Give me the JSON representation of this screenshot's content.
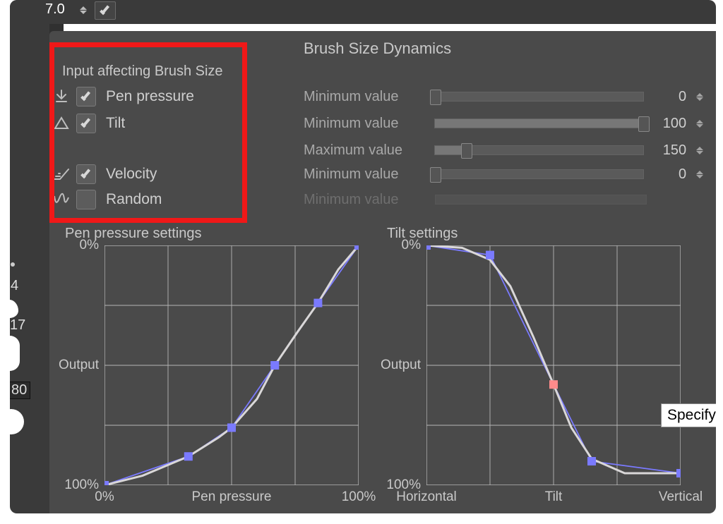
{
  "top": {
    "value": "7.0"
  },
  "panel": {
    "title": "Brush Size Dynamics"
  },
  "inputs": {
    "section_title": "Input affecting Brush Size",
    "items": [
      {
        "label": "Pen pressure",
        "checked": true,
        "icon": "pressure-icon"
      },
      {
        "label": "Tilt",
        "checked": true,
        "icon": "tilt-icon"
      },
      {
        "label": "Velocity",
        "checked": true,
        "icon": "velocity-icon"
      },
      {
        "label": "Random",
        "checked": false,
        "icon": "random-icon"
      }
    ]
  },
  "sliders": [
    {
      "label": "Minimum value",
      "value": 0,
      "min": 0,
      "max": 100,
      "disabled": false
    },
    {
      "label": "Minimum value",
      "value": 100,
      "min": 0,
      "max": 100,
      "disabled": false
    },
    {
      "label": "Maximum value",
      "value": 150,
      "min": 0,
      "max": 1000,
      "disabled": false
    },
    {
      "label": "Minimum value",
      "value": 0,
      "min": 0,
      "max": 100,
      "disabled": false
    },
    {
      "label": "Minimum value",
      "value": "",
      "min": 0,
      "max": 100,
      "disabled": true
    }
  ],
  "chart_data": [
    {
      "type": "line",
      "title": "Pen pressure settings",
      "xlabel": "Pen pressure",
      "ylabel": "Output",
      "x_tick_labels": [
        "0%",
        "Pen pressure",
        "100%"
      ],
      "y_tick_labels": [
        "0%",
        "Output",
        "100%"
      ],
      "xlim": [
        0,
        100
      ],
      "ylim": [
        0,
        100
      ],
      "control_points": [
        {
          "x": 0,
          "y": 0
        },
        {
          "x": 33,
          "y": 12
        },
        {
          "x": 50,
          "y": 24
        },
        {
          "x": 67,
          "y": 50
        },
        {
          "x": 84,
          "y": 76
        },
        {
          "x": 100,
          "y": 100
        }
      ],
      "curve_points": [
        {
          "x": 0,
          "y": 0
        },
        {
          "x": 15,
          "y": 4
        },
        {
          "x": 33,
          "y": 12
        },
        {
          "x": 45,
          "y": 20
        },
        {
          "x": 50,
          "y": 24
        },
        {
          "x": 60,
          "y": 36
        },
        {
          "x": 67,
          "y": 50
        },
        {
          "x": 76,
          "y": 64
        },
        {
          "x": 84,
          "y": 76
        },
        {
          "x": 92,
          "y": 90
        },
        {
          "x": 100,
          "y": 100
        }
      ]
    },
    {
      "type": "line",
      "title": "Tilt settings",
      "xlabel": "Tilt",
      "ylabel": "Output",
      "x_tick_labels": [
        "Horizontal",
        "Tilt",
        "Vertical"
      ],
      "y_tick_labels": [
        "0%",
        "Output",
        "100%"
      ],
      "xlim": [
        0,
        100
      ],
      "ylim": [
        0,
        100
      ],
      "control_points": [
        {
          "x": 0,
          "y": 100
        },
        {
          "x": 25,
          "y": 96
        },
        {
          "x": 50,
          "y": 42,
          "active": true
        },
        {
          "x": 65,
          "y": 10
        },
        {
          "x": 100,
          "y": 5
        }
      ],
      "curve_points": [
        {
          "x": 0,
          "y": 100
        },
        {
          "x": 14,
          "y": 99
        },
        {
          "x": 25,
          "y": 94
        },
        {
          "x": 33,
          "y": 83
        },
        {
          "x": 42,
          "y": 62
        },
        {
          "x": 50,
          "y": 42
        },
        {
          "x": 57,
          "y": 24
        },
        {
          "x": 65,
          "y": 11
        },
        {
          "x": 78,
          "y": 5
        },
        {
          "x": 100,
          "y": 5
        }
      ]
    }
  ],
  "tooltip": {
    "text": "Specify ou"
  },
  "colors": {
    "highlight": "#f01818",
    "panel_bg": "#4a4a4a",
    "grid_line": "#b8b8b8",
    "curve": "#d7d5d6",
    "handle": "#7a7aff",
    "handle_active": "#ff8b8b"
  }
}
